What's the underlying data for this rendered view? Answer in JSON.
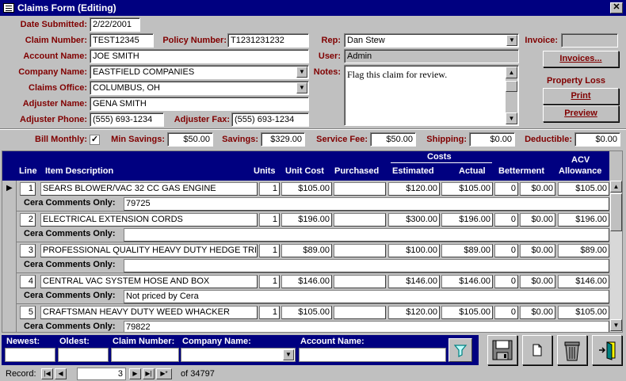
{
  "window": {
    "title": "Claims Form (Editing)",
    "close": "✕"
  },
  "header": {
    "date_submitted_label": "Date Submitted:",
    "date_submitted": "2/22/2001",
    "claim_number_label": "Claim Number:",
    "claim_number": "TEST12345",
    "policy_number_label": "Policy Number:",
    "policy_number": "T1231231232",
    "account_name_label": "Account Name:",
    "account_name": "JOE SMITH",
    "company_name_label": "Company Name:",
    "company_name": "EASTFIELD COMPANIES",
    "claims_office_label": "Claims Office:",
    "claims_office": "COLUMBUS, OH",
    "adjuster_name_label": "Adjuster Name:",
    "adjuster_name": "GENA SMITH",
    "adjuster_phone_label": "Adjuster Phone:",
    "adjuster_phone": "(555) 693-1234",
    "adjuster_fax_label": "Adjuster Fax:",
    "adjuster_fax": "(555) 693-1234",
    "rep_label": "Rep:",
    "rep": "Dan Stew",
    "user_label": "User:",
    "user": "Admin",
    "notes_label": "Notes:",
    "notes": "Flag this claim for review.",
    "invoice_label": "Invoice:",
    "invoice": "",
    "invoices_button": "Invoices...",
    "property_loss_label": "Property Loss",
    "print_button": "Print",
    "preview_button": "Preview"
  },
  "summary": {
    "bill_monthly_label": "Bill Monthly:",
    "bill_monthly_checked": "✓",
    "min_savings_label": "Min Savings:",
    "min_savings": "$50.00",
    "savings_label": "Savings:",
    "savings": "$329.00",
    "service_fee_label": "Service Fee:",
    "service_fee": "$50.00",
    "shipping_label": "Shipping:",
    "shipping": "$0.00",
    "deductible_label": "Deductible:",
    "deductible": "$0.00"
  },
  "grid": {
    "headers": {
      "line": "Line",
      "item": "Item Description",
      "units": "Units",
      "unit_cost": "Unit Cost",
      "purchased": "Purchased",
      "costs": "Costs",
      "estimated": "Estimated",
      "actual": "Actual",
      "betterment": "Betterment",
      "acv1": "ACV",
      "acv2": "Allowance"
    },
    "comments_label": "Cera Comments Only:",
    "rows": [
      {
        "line": "1",
        "item": "SEARS BLOWER/VAC 32 CC GAS ENGINE",
        "units": "1",
        "unit_cost": "$105.00",
        "purchased": "",
        "estimated": "$120.00",
        "actual": "$105.00",
        "bet_pct": "0",
        "bet_amt": "$0.00",
        "acv": "$105.00",
        "comment": "79725"
      },
      {
        "line": "2",
        "item": "ELECTRICAL EXTENSION CORDS",
        "units": "1",
        "unit_cost": "$196.00",
        "purchased": "",
        "estimated": "$300.00",
        "actual": "$196.00",
        "bet_pct": "0",
        "bet_amt": "$0.00",
        "acv": "$196.00",
        "comment": ""
      },
      {
        "line": "3",
        "item": "PROFESSIONAL QUALITY HEAVY DUTY HEDGE TRIM",
        "units": "1",
        "unit_cost": "$89.00",
        "purchased": "",
        "estimated": "$100.00",
        "actual": "$89.00",
        "bet_pct": "0",
        "bet_amt": "$0.00",
        "acv": "$89.00",
        "comment": ""
      },
      {
        "line": "4",
        "item": "CENTRAL VAC SYSTEM HOSE AND BOX",
        "units": "1",
        "unit_cost": "$146.00",
        "purchased": "",
        "estimated": "$146.00",
        "actual": "$146.00",
        "bet_pct": "0",
        "bet_amt": "$0.00",
        "acv": "$146.00",
        "comment": "Not priced by Cera"
      },
      {
        "line": "5",
        "item": "CRAFTSMAN HEAVY DUTY WEED WHACKER",
        "units": "1",
        "unit_cost": "$105.00",
        "purchased": "",
        "estimated": "$120.00",
        "actual": "$105.00",
        "bet_pct": "0",
        "bet_amt": "$0.00",
        "acv": "$105.00",
        "comment": "79822"
      }
    ]
  },
  "filter": {
    "newest": "Newest:",
    "oldest": "Oldest:",
    "claim_number": "Claim Number:",
    "company_name": "Company Name:",
    "account_name": "Account Name:"
  },
  "status": {
    "record_label": "Record:",
    "record": "3",
    "of_label": "of  34797"
  }
}
